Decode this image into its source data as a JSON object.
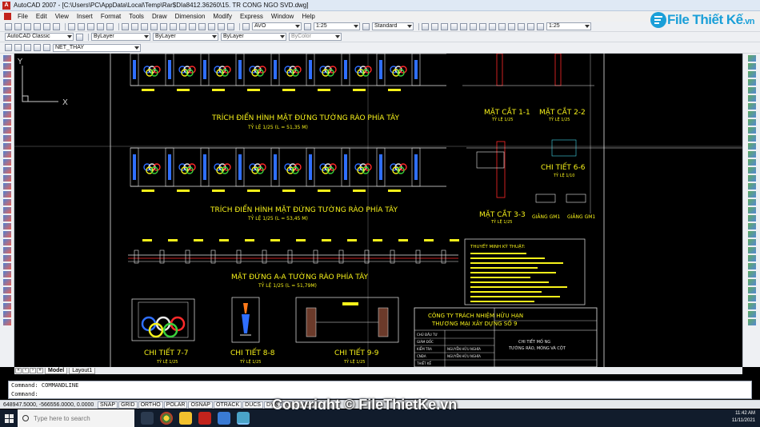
{
  "window": {
    "title": "AutoCAD 2007 - [C:\\Users\\PC\\AppData\\Local\\Temp\\Rar$DIa8412.36260\\15. TR CONG NGO SVD.dwg]"
  },
  "menu": [
    "File",
    "Edit",
    "View",
    "Insert",
    "Format",
    "Tools",
    "Draw",
    "Dimension",
    "Modify",
    "Express",
    "Window",
    "Help"
  ],
  "toolbar1": {
    "text_style": "AVO",
    "dim_scale": "1:25",
    "dim_style": "Standard",
    "right_scale": "1:25"
  },
  "toolbar2": {
    "workspace": "AutoCAD Classic",
    "color": "ByLayer",
    "linetype": "ByLayer",
    "lineweight": "ByLayer",
    "plot_style": "ByColor"
  },
  "toolbar3": {
    "layer": "NET_THAY"
  },
  "drawing": {
    "elev_title_1": "TRÍCH ĐIỂN HÌNH MẶT ĐỨNG TƯỜNG RÀO PHÍA TÂY",
    "elev_scale_1": "TỶ LỆ 1/25 (L = 51,35 M)",
    "elev_title_2": "TRÍCH ĐIỂN HÌNH MẶT ĐỨNG TƯỜNG RÀO PHÍA TÂY",
    "elev_scale_2": "TỶ LỆ 1/25 (L = 53,45 M)",
    "section_title": "MẶT ĐỨNG A-A TƯỜNG RÀO PHÍA TÂY",
    "section_scale": "TỶ LỆ 1/25 (L = 51,79M)",
    "cut_1_1": "MẶT CẮT 1-1",
    "cut_2_2": "MẶT CẮT 2-2",
    "cut_3_3": "MẶT CẮT 3-3",
    "detail_6_6": "CHI TIẾT 6-6",
    "gm1_a": "GIẰNG GM1",
    "gm1_b": "GIẰNG GM1",
    "detail_7_7": "CHI TIẾT 7-7",
    "detail_8_8": "CHI TIẾT 8-8",
    "detail_9_9": "CHI TIẾT 9-9",
    "scale_125": "TỶ LỆ 1/25",
    "scale_110": "TỶ LỆ 1/10",
    "notes_title": "THUYẾT MINH KỸ THUẬT:",
    "company_line1": "CÔNG TY TRÁCH NHIỆM HỮU HẠN",
    "company_line2": "THƯƠNG MẠI XÂY DỰNG SỐ 9",
    "tb_role1": "CHỦ ĐẦU TƯ",
    "tb_role2": "GIÁM ĐỐC",
    "tb_role3": "KIỂM TRA",
    "tb_role4": "CNĐA",
    "tb_role5": "THIẾT KẾ",
    "tb_role6": "VẼ",
    "tb_name1": "NGUYỄN HỮU NGHĨA",
    "tb_name2": "NGUYỄN HỮU NGHĨA",
    "tb_sheet_title1": "CHI TIẾT MỐ NG",
    "tb_sheet_title2": "TƯỜNG RÀO, MÓNG VÀ CỘT"
  },
  "ucs": {
    "x_label": "X",
    "y_label": "Y"
  },
  "layout_tabs": [
    "Model",
    "Layout1"
  ],
  "command": {
    "line1": "Command: COMMANDLINE",
    "line2": "Command:"
  },
  "status": {
    "coords": "648947.5000, -566556.0000, 0.0000",
    "buttons": [
      "SNAP",
      "GRID",
      "ORTHO",
      "POLAR",
      "OSNAP",
      "OTRACK",
      "DUCS",
      "DYN",
      "LWT",
      "MODEL"
    ]
  },
  "taskbar": {
    "search_placeholder": "Type here to search",
    "time": "11:42 AM",
    "date": "11/11/2021"
  },
  "watermark": {
    "logo_main": "File Thiết Kế",
    "logo_domain": ".vn",
    "copyright": "Copyright © FileThietKe.vn"
  },
  "colors": {
    "canvas_bg": "#000000",
    "cad_yellow": "#f7f21a",
    "cad_red": "#ff2a2a",
    "cad_white": "#e8e8e8",
    "cad_cyan": "#45d7e8",
    "watermark_blue": "#1a9fd8"
  }
}
